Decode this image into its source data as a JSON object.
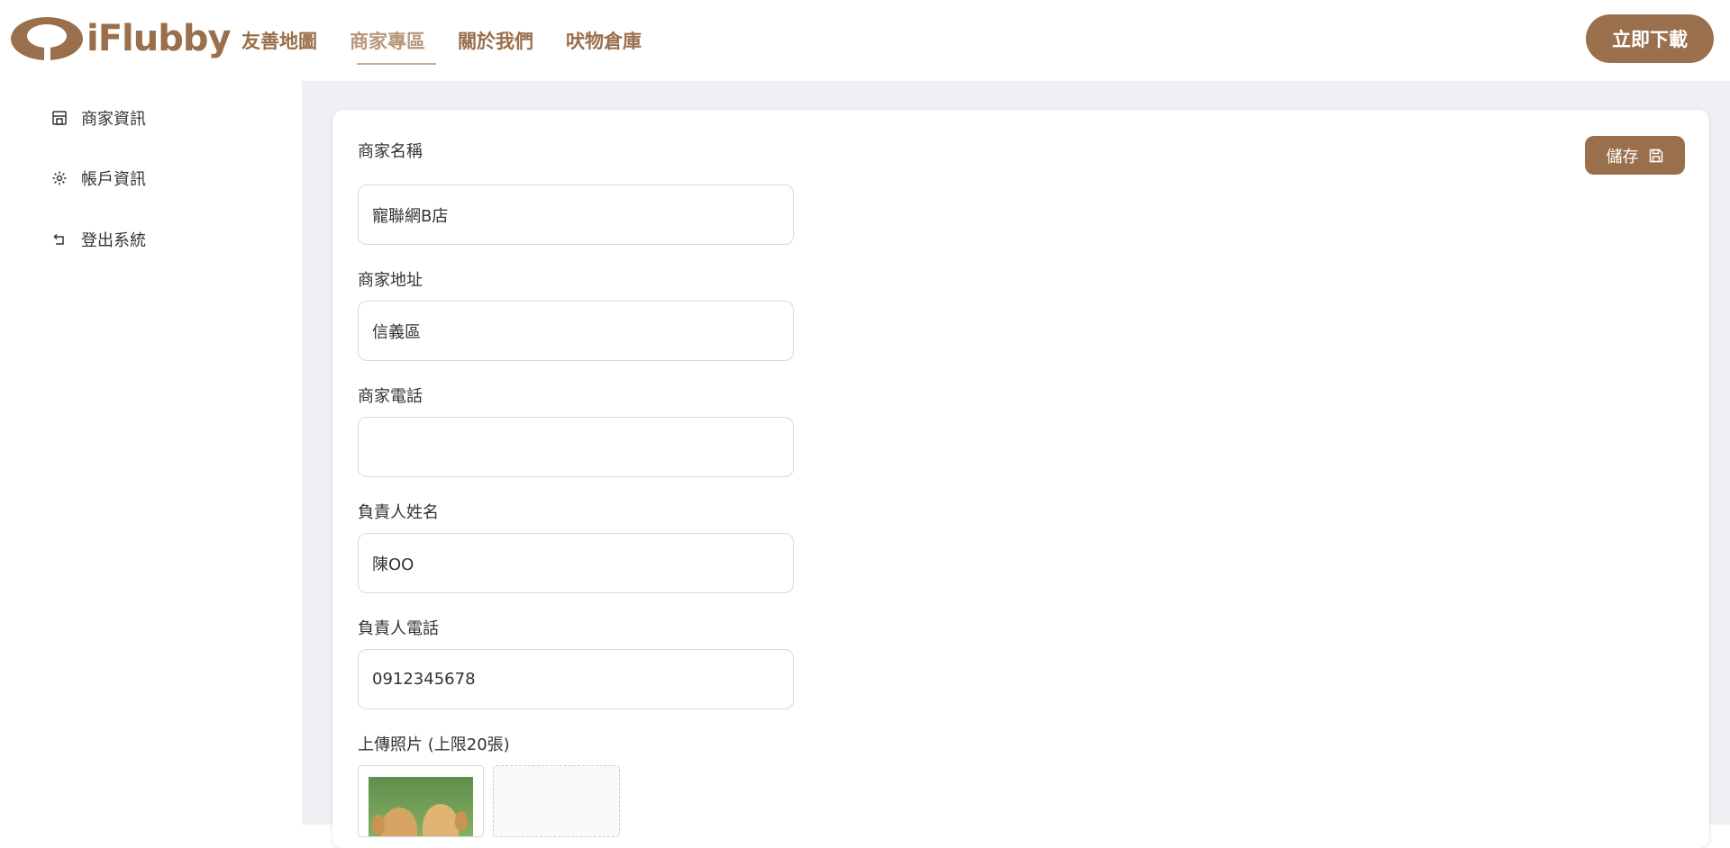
{
  "brand": {
    "logo_text": "iFlubby",
    "color": "#9a6f4c"
  },
  "nav": {
    "items": [
      {
        "label": "友善地圖"
      },
      {
        "label": "商家專區"
      },
      {
        "label": "關於我們"
      },
      {
        "label": "吠物倉庫"
      }
    ],
    "active_index": 1
  },
  "header": {
    "download_label": "立即下載"
  },
  "sidebar": {
    "items": [
      {
        "label": "商家資訊",
        "icon": "store-icon"
      },
      {
        "label": "帳戶資訊",
        "icon": "gear-icon"
      },
      {
        "label": "登出系統",
        "icon": "logout-icon"
      }
    ]
  },
  "form": {
    "save_label": "儲存",
    "fields": [
      {
        "label": "商家名稱",
        "value": "寵聯網B店"
      },
      {
        "label": "商家地址",
        "value": "信義區"
      },
      {
        "label": "商家電話",
        "value": ""
      },
      {
        "label": "負責人姓名",
        "value": "陳OO"
      },
      {
        "label": "負責人電話",
        "value": "0912345678"
      }
    ],
    "upload_label": "上傳照片 (上限20張)"
  }
}
